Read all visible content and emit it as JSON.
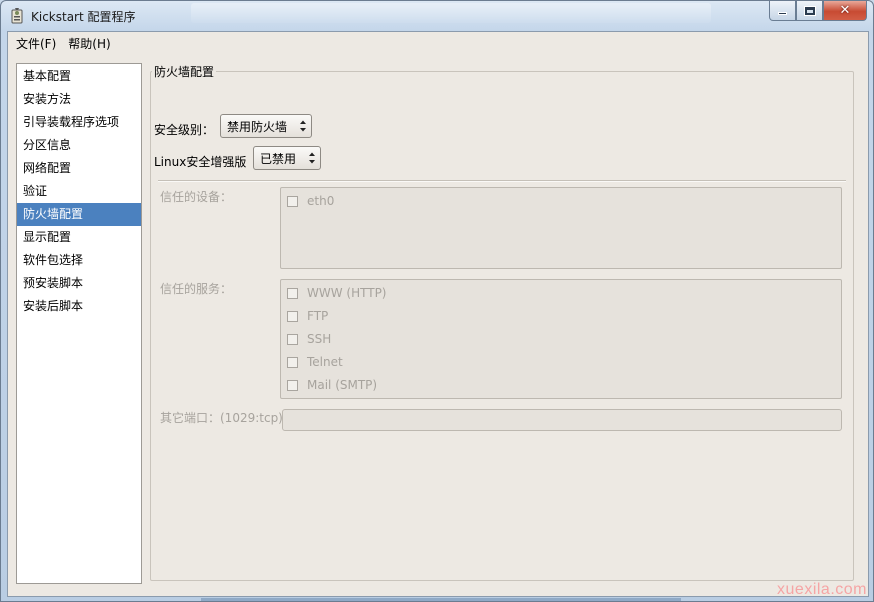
{
  "window": {
    "title": "Kickstart 配置程序"
  },
  "menu": {
    "file": "文件(F)",
    "help": "帮助(H)"
  },
  "sidebar": {
    "items": [
      {
        "label": "基本配置"
      },
      {
        "label": "安装方法"
      },
      {
        "label": "引导装载程序选项"
      },
      {
        "label": "分区信息"
      },
      {
        "label": "网络配置"
      },
      {
        "label": "验证"
      },
      {
        "label": "防火墙配置",
        "selected": true
      },
      {
        "label": "显示配置"
      },
      {
        "label": "软件包选择"
      },
      {
        "label": "预安装脚本"
      },
      {
        "label": "安装后脚本"
      }
    ]
  },
  "firewall": {
    "group_title": "防火墙配置",
    "security_level_label": "安全级别：",
    "security_level_value": "禁用防火墙",
    "selinux_label": "Linux安全增强版",
    "selinux_value": "已禁用",
    "trusted_devices_label": "信任的设备：",
    "trusted_devices": [
      "eth0"
    ],
    "trusted_services_label": "信任的服务：",
    "trusted_services": [
      "WWW (HTTP)",
      "FTP",
      "SSH",
      "Telnet",
      "Mail (SMTP)"
    ],
    "other_ports_label": "其它端口：(1029:tcp)",
    "other_ports_value": ""
  },
  "watermark": "xuexila.com",
  "colors": {
    "selection": "#4b81bf",
    "background": "#ede9e3",
    "disabled_text": "#a7a39d"
  }
}
